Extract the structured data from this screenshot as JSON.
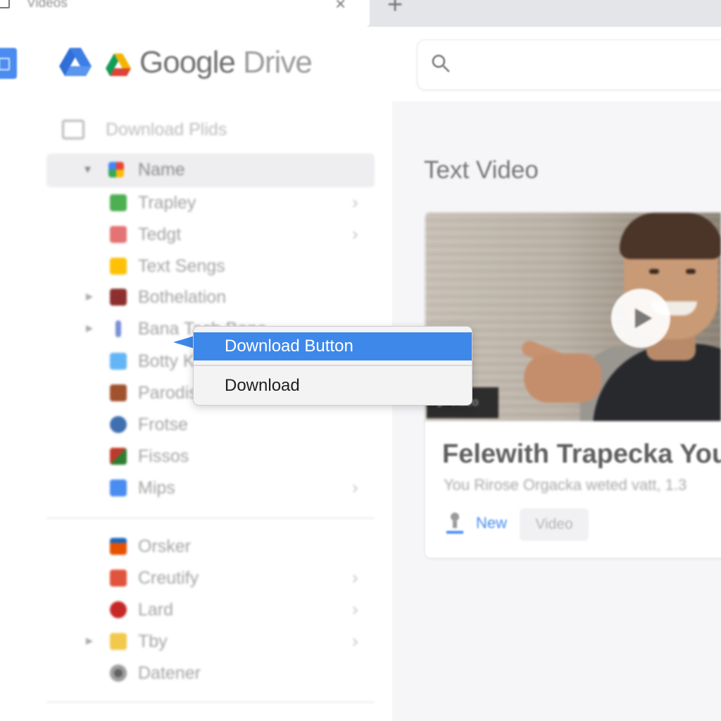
{
  "browser": {
    "tab_title": "Videos",
    "close_glyph": "×",
    "new_tab_glyph": "+"
  },
  "header": {
    "app_name": "Google",
    "app_name_suffix": " Drive",
    "search_icon": "search-icon",
    "logo_icon": "google-drive-icon"
  },
  "sidebar": {
    "heading": "Download Plids",
    "name_row": {
      "label": "Name",
      "caret": "▾"
    },
    "items": [
      {
        "label": "Trapley",
        "icon_color": "#4caf50",
        "chevron": "›",
        "expand": ""
      },
      {
        "label": "Tedgt",
        "icon_color": "#e57373",
        "chevron": "›",
        "expand": ""
      },
      {
        "label": "Text Sengs",
        "icon_color": "#ffc107",
        "chevron": "",
        "expand": ""
      },
      {
        "label": "Bothelation",
        "icon_color": "#8d2f2f",
        "chevron": "",
        "expand": "▸"
      },
      {
        "label": "Bana Tach Bone",
        "icon_color": "#7a8fd8",
        "chevron": "",
        "expand": "▸"
      },
      {
        "label": "Botty Kat",
        "icon_color": "#64b5f6",
        "chevron": "",
        "expand": ""
      },
      {
        "label": "Parodis",
        "icon_color": "#a0522d",
        "chevron": "",
        "expand": ""
      },
      {
        "label": "Frotse",
        "icon_color": "#3f6fb0",
        "chevron": "",
        "expand": ""
      },
      {
        "label": "Fissos",
        "icon_color": "#c0392b",
        "chevron": "",
        "expand": ""
      },
      {
        "label": "Mips",
        "icon_color": "#4a8cf0",
        "chevron": "›",
        "expand": ""
      }
    ],
    "items2": [
      {
        "label": "Orsker",
        "icon_color": "#e65100",
        "chevron": "",
        "expand": ""
      },
      {
        "label": "Creutify",
        "icon_color": "#e0533c",
        "chevron": "›",
        "expand": ""
      },
      {
        "label": "Lard",
        "icon_color": "#c62828",
        "chevron": "›",
        "expand": ""
      },
      {
        "label": "Tby",
        "icon_color": "#f2c94c",
        "chevron": "›",
        "expand": "▸"
      },
      {
        "label": "Datener",
        "icon_color": "#616161",
        "chevron": "",
        "expand": ""
      }
    ]
  },
  "context_menu": {
    "highlighted_item": "Download Button",
    "item": "Download",
    "highlight_color": "#3e88ea"
  },
  "main": {
    "section_title": "Text Video",
    "card": {
      "badge": "▶ Video",
      "title": "Felewith Trapecka You",
      "subtitle": "You Rirose Orgacka weted vatt, 1.3",
      "new_label": "New",
      "chip_label": "Video",
      "play_icon": "play-icon"
    }
  }
}
